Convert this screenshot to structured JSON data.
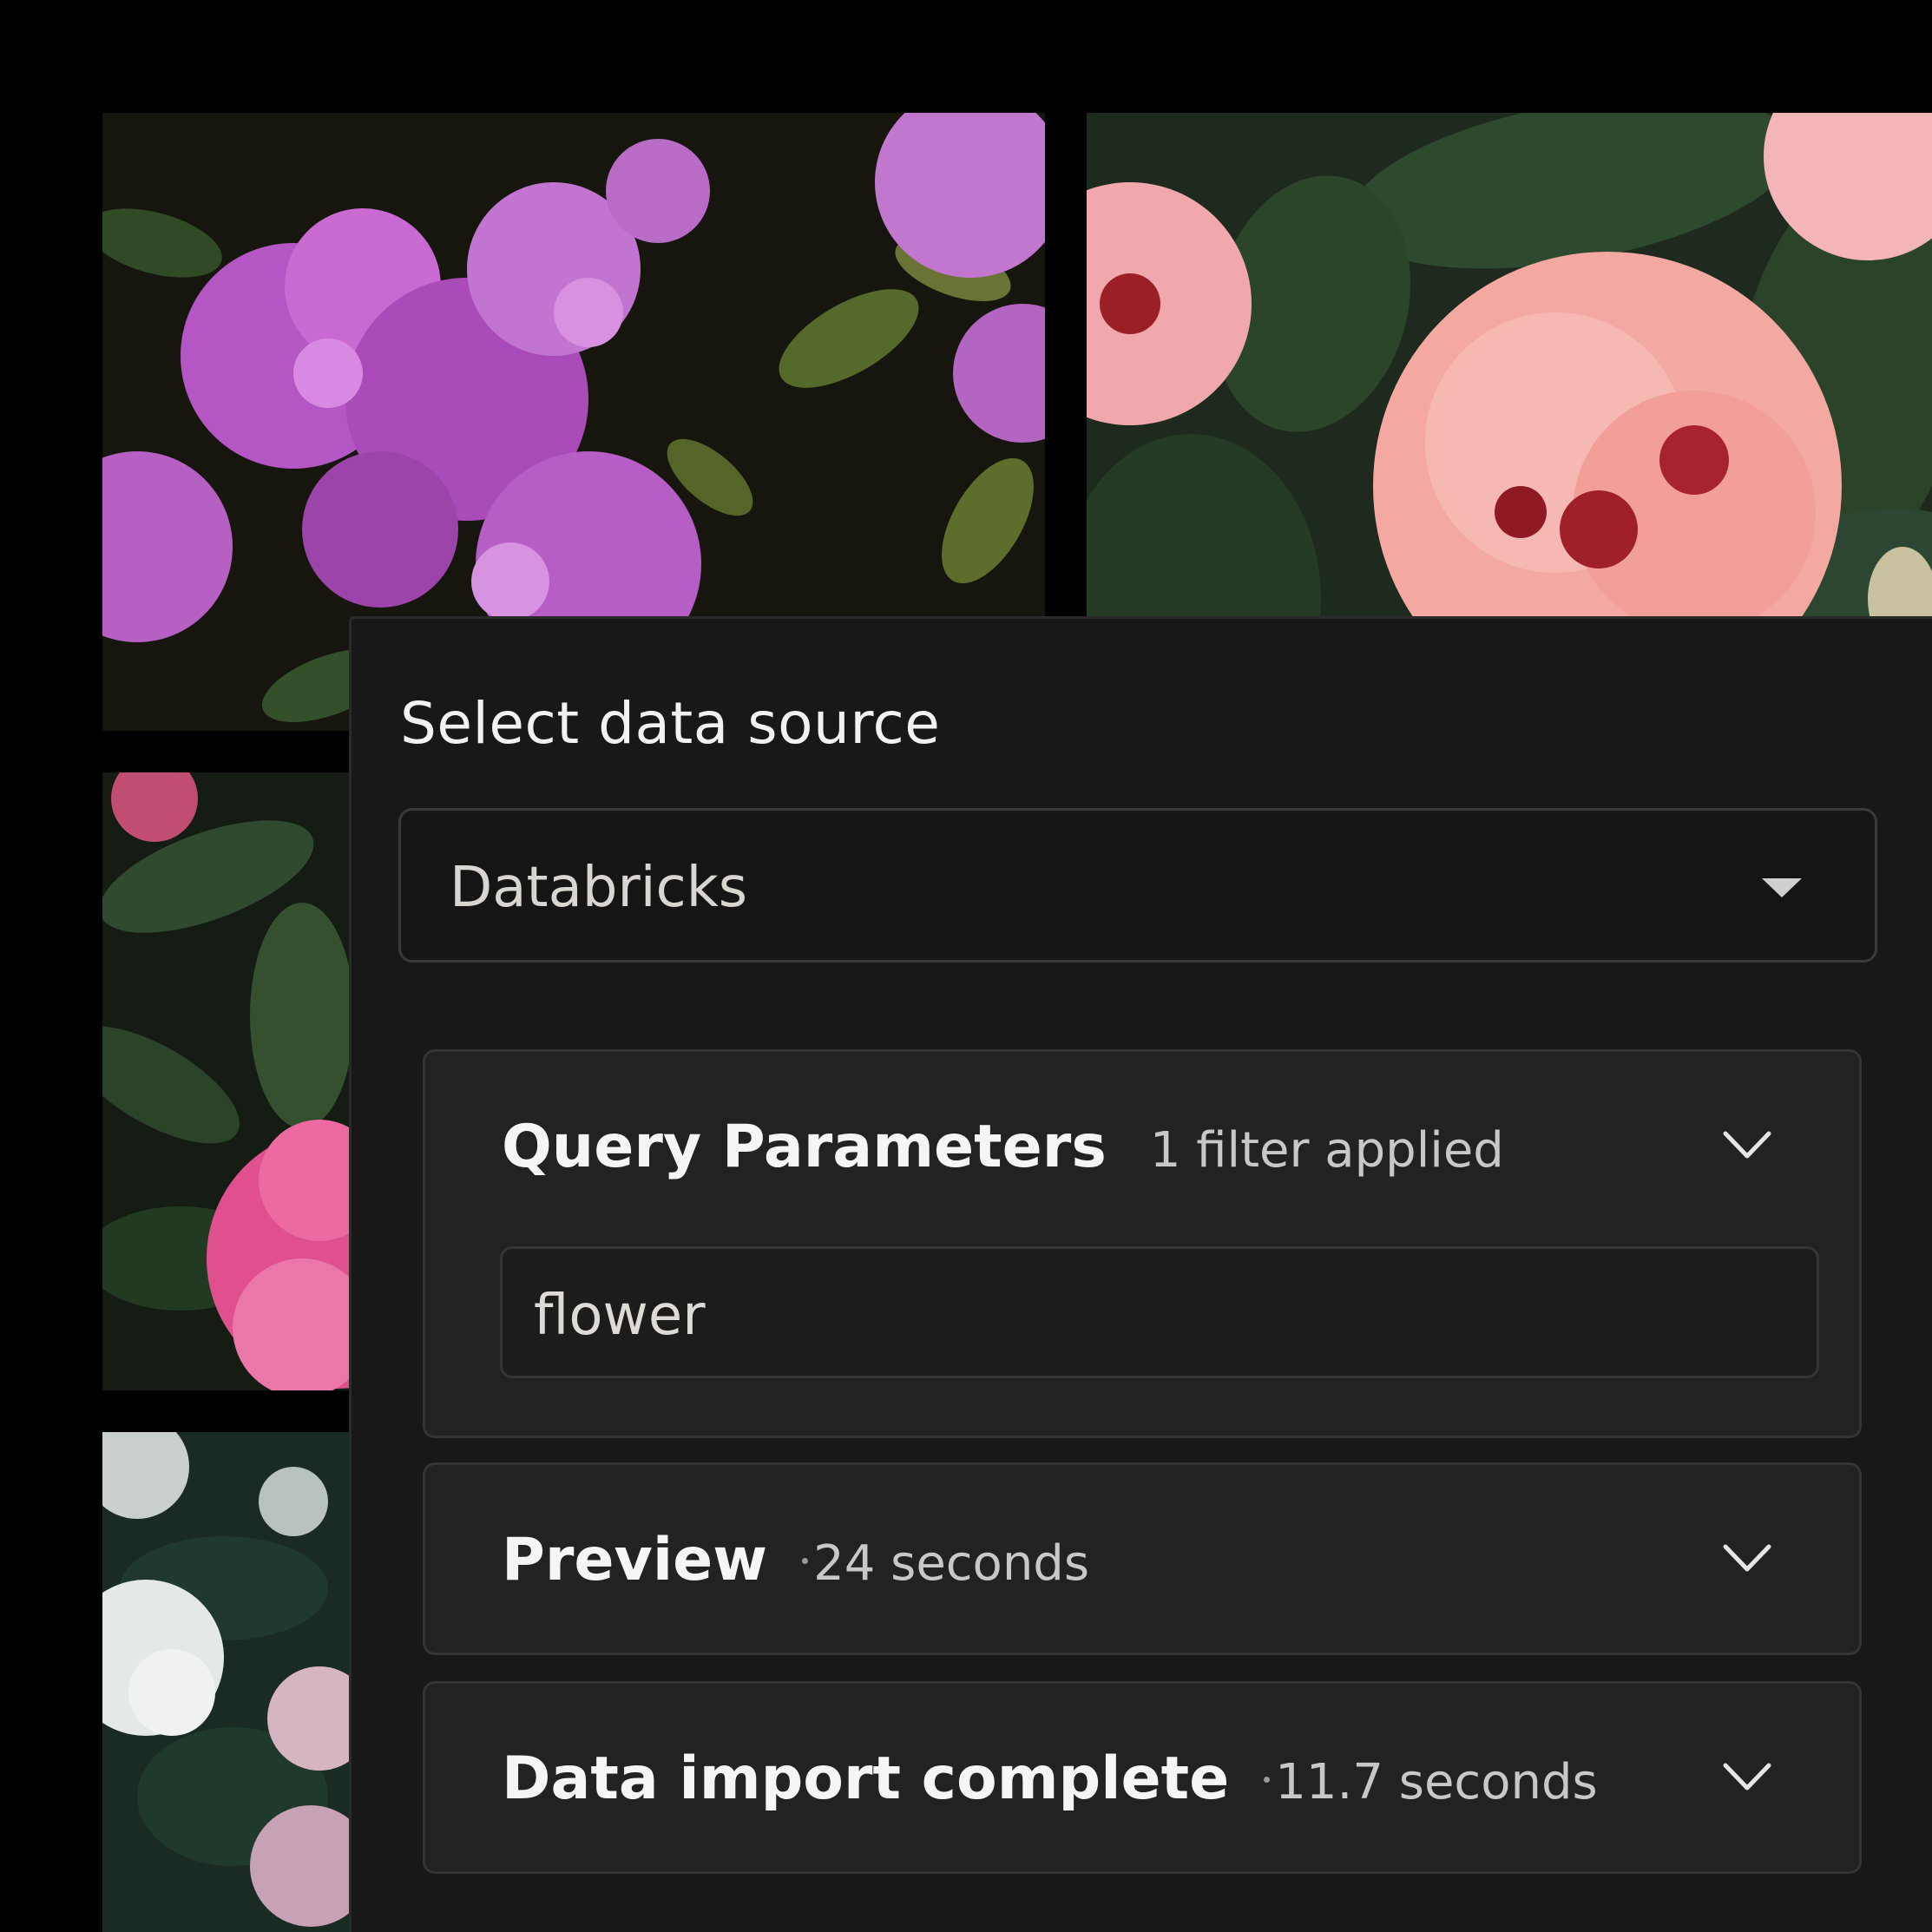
{
  "panel": {
    "title": "Select data source"
  },
  "data_source": {
    "selected": "Databricks",
    "caret_icon": "caret-down-icon"
  },
  "sections": {
    "query": {
      "title": "Query Parameters",
      "meta": "1 filter applied",
      "filter_value": "flower",
      "expand_icon": "chevron-down-icon"
    },
    "preview": {
      "title": "Preview",
      "meta": "24 seconds",
      "expand_icon": "chevron-down-icon"
    },
    "import": {
      "title": "Data import complete",
      "meta": "11.7 seconds",
      "expand_icon": "chevron-down-icon"
    }
  },
  "gallery": {
    "images": [
      "purple-rhododendron",
      "pink-rhododendron",
      "magenta-rhododendron",
      "white-rhododendron"
    ]
  },
  "colors": {
    "background": "#000000",
    "panel": "#181818",
    "section": "#222222",
    "text_primary": "#f5f5f5",
    "text_secondary": "#c8c8c8"
  }
}
